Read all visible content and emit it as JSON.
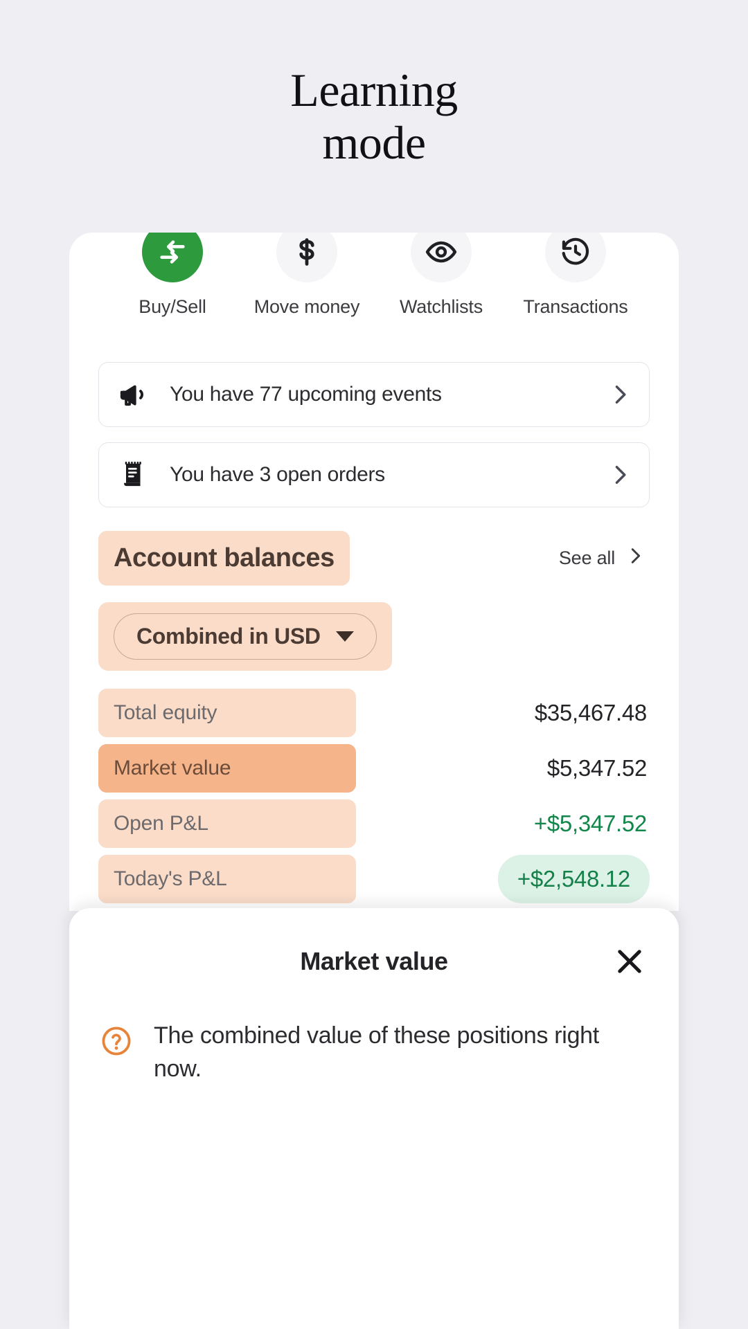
{
  "hero": {
    "title": "Learning\nmode"
  },
  "quick_actions": [
    {
      "label": "Buy/Sell",
      "icon": "transfer-arrows-icon",
      "active": true
    },
    {
      "label": "Move money",
      "icon": "dollar-sign-icon",
      "active": false
    },
    {
      "label": "Watchlists",
      "icon": "eye-icon",
      "active": false
    },
    {
      "label": "Transactions",
      "icon": "history-clock-icon",
      "active": false
    }
  ],
  "notices": [
    {
      "text": "You have 77 upcoming events",
      "icon": "megaphone-icon"
    },
    {
      "text": "You have 3 open orders",
      "icon": "receipt-icon"
    }
  ],
  "balances": {
    "title": "Account balances",
    "see_all_label": "See all",
    "currency_selector": "Combined in USD",
    "rows": [
      {
        "label": "Total equity",
        "value": "$35,467.48",
        "style": "plain",
        "highlight": "light"
      },
      {
        "label": "Market value",
        "value": "$5,347.52",
        "style": "plain",
        "highlight": "strong"
      },
      {
        "label": "Open P&L",
        "value": "+$5,347.52",
        "style": "positive",
        "highlight": "light"
      },
      {
        "label": "Today's P&L",
        "value": "+$2,548.12",
        "style": "chip",
        "highlight": "light"
      }
    ]
  },
  "sheet": {
    "title": "Market value",
    "description": "The combined value of these positions right now.",
    "close_label": "Close"
  },
  "colors": {
    "page_background": "#efeef2",
    "accent_green": "#2e9a3e",
    "highlight_peach": "#fadcc9",
    "highlight_peach_strong": "#f5b489",
    "positive_green": "#13874b",
    "chip_green_bg": "#dcf2e6",
    "help_orange": "#e8833a"
  }
}
